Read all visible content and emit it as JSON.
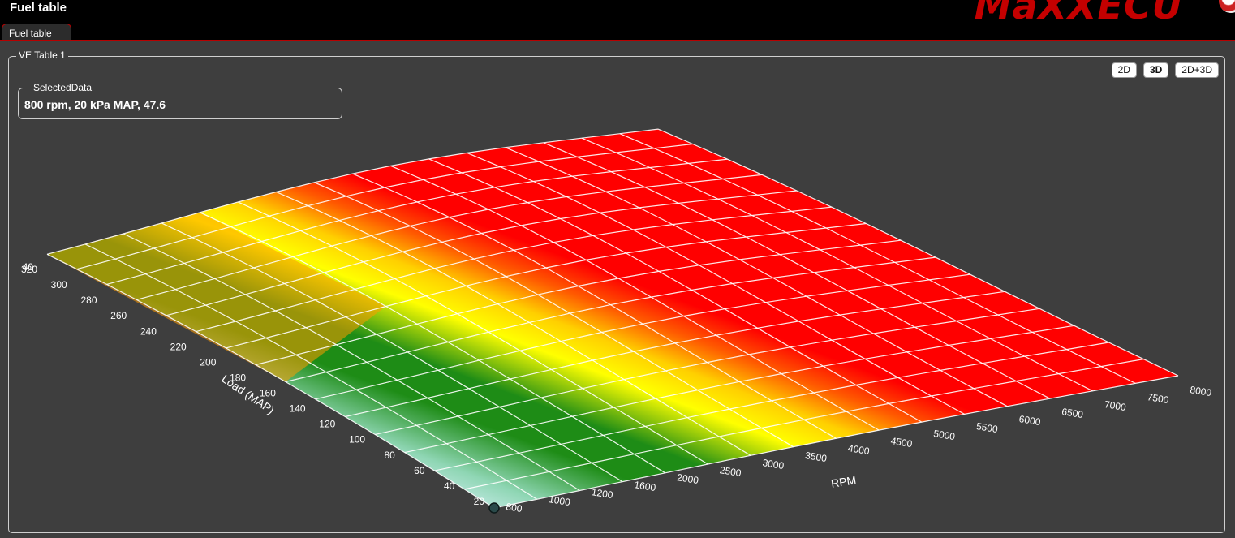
{
  "window": {
    "title": "Fuel table",
    "brand": "MaXXECU"
  },
  "tabs": [
    {
      "label": "Fuel table"
    }
  ],
  "group": {
    "title": "VE Table 1"
  },
  "view_buttons": [
    {
      "label": "2D",
      "active": false
    },
    {
      "label": "3D",
      "active": true
    },
    {
      "label": "2D+3D",
      "active": false
    }
  ],
  "selected": {
    "title": "SelectedData",
    "value": "800 rpm, 20 kPa MAP, 47.6"
  },
  "chart_data": {
    "type": "surface",
    "xlabel": "Load (MAP)",
    "ylabel": "RPM",
    "zlabel": "",
    "colors": {
      "low": "#cfeef0",
      "mid_low": "#1e8c16",
      "mid": "#ffff00",
      "high": "#ff0000"
    },
    "load_kpa": [
      20,
      40,
      60,
      80,
      100,
      120,
      140,
      160,
      180,
      200,
      220,
      240,
      260,
      280,
      300,
      320
    ],
    "rpm": [
      800,
      1000,
      1200,
      1600,
      2000,
      2500,
      3000,
      3500,
      4000,
      4500,
      5000,
      5500,
      6000,
      6500,
      7000,
      7500,
      8000
    ],
    "load_tick_labels": [
      "20",
      "40",
      "60",
      "80",
      "100",
      "120",
      "140",
      "160",
      "180",
      "200",
      "220",
      "240",
      "260",
      "280",
      "300",
      "320"
    ],
    "rpm_tick_labels": [
      "800",
      "1000",
      "1200",
      "1600",
      "2000",
      "2500",
      "3000",
      "3500",
      "4000",
      "4500",
      "5000",
      "5500",
      "6000",
      "6500",
      "7000",
      "7500",
      "8000"
    ],
    "z_tick_label": "40",
    "selected_point": {
      "rpm": 800,
      "load_kpa": 20,
      "ve": 47.6
    }
  }
}
